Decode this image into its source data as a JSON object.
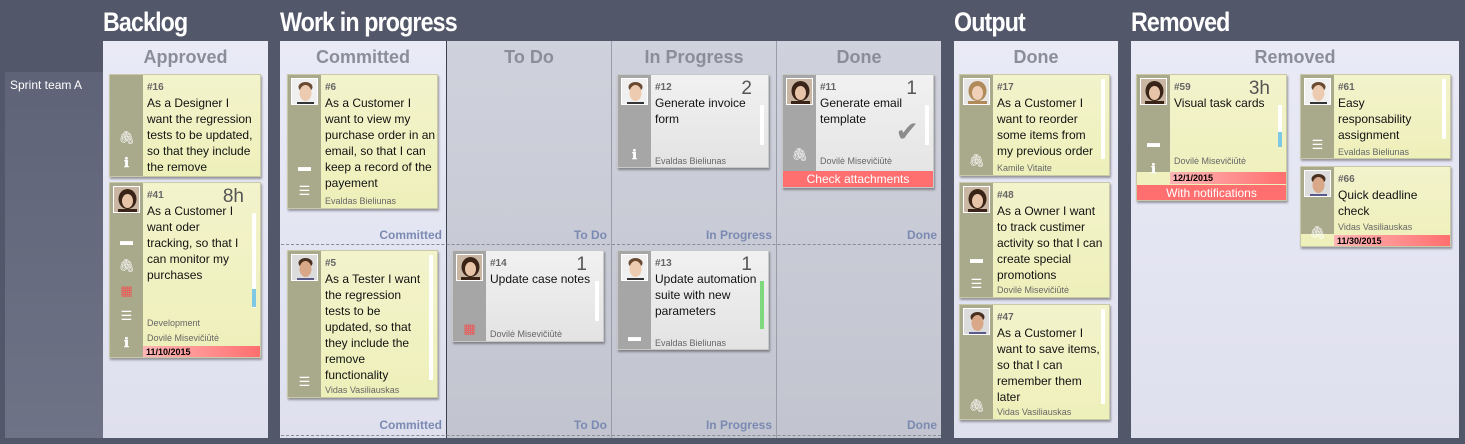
{
  "sections": {
    "backlog": "Backlog",
    "wip": "Work in progress",
    "output": "Output",
    "removed": "Removed"
  },
  "lane": {
    "label": "Sprint team A"
  },
  "columns": {
    "approved": "Approved",
    "committed": "Committed",
    "todo": "To Do",
    "inprogress": "In Progress",
    "done": "Done",
    "output_done": "Done",
    "removed": "Removed"
  },
  "sublabels": {
    "committed_top": "Committed",
    "committed_bottom": "Committed",
    "todo_top": "To Do",
    "todo_bottom": "To Do",
    "inprogress_top": "In Progress",
    "inprogress_bottom": "In Progress",
    "done_top": "Done",
    "done_bottom": "Done"
  },
  "cards": {
    "c16": {
      "id": "#16",
      "title": "As a Designer I want the regression tests to be updated, so that they include the remove functionality"
    },
    "c41": {
      "id": "#41",
      "title": "As a Customer I want oder tracking, so that I can monitor my purchases",
      "estimate": "8h",
      "tag": "Development",
      "owner": "Dovilė Misevičiūtė",
      "date": "11/10/2015"
    },
    "c6": {
      "id": "#6",
      "title": "As a Customer I want to view my purchase order in an email, so that I can keep a record of the payement",
      "owner": "Evaldas Bieliunas"
    },
    "c5": {
      "id": "#5",
      "title": "As a Tester I want the regression tests to be updated, so that they include the remove functionality",
      "owner": "Vidas Vasiliauskas"
    },
    "c14": {
      "id": "#14",
      "title": "Update case notes",
      "estimate": "1",
      "owner": "Dovilė Misevičiūtė"
    },
    "c12": {
      "id": "#12",
      "title": "Generate invoice form",
      "estimate": "2",
      "owner": "Evaldas Bieliunas"
    },
    "c13": {
      "id": "#13",
      "title": "Update automation suite with new parameters",
      "estimate": "1",
      "owner": "Evaldas Bieliunas"
    },
    "c11": {
      "id": "#11",
      "title": "Generate email template",
      "estimate": "1",
      "owner": "Dovilė Misevičiūtė",
      "bar": "Check attachments"
    },
    "c17": {
      "id": "#17",
      "title": "As a Customer I want to reorder some items from my previous order",
      "owner": "Kamile  Vitaite"
    },
    "c48": {
      "id": "#48",
      "title": "As a Owner I want to track custimer activity so that I can create special promotions",
      "owner": "Dovilė Misevičiūtė"
    },
    "c47": {
      "id": "#47",
      "title": "As a Customer I want to save items, so that I can remember them later",
      "owner": "Vidas Vasiliauskas"
    },
    "c59": {
      "id": "#59",
      "title": "Visual task cards",
      "estimate": "3h",
      "owner": "Dovilė Misevičiūtė",
      "date": "12/1/2015",
      "bar": "With notifications"
    },
    "c61": {
      "id": "#61",
      "title": "Easy responsability assignment",
      "owner": "Evaldas Bieliunas"
    },
    "c66": {
      "id": "#66",
      "title": "Quick deadline check",
      "owner": "Vidas Vasiliauskas",
      "date": "11/30/2015"
    }
  },
  "icons": [
    "paperclip-icon",
    "info-icon",
    "comment-icon",
    "calendar-icon",
    "cards-icon",
    "checkmark-icon"
  ],
  "colors": {
    "background": "#53576a",
    "card_yellow": "#f1f2c4",
    "card_white": "#eeeeee",
    "alert_red": "#ff6f6f",
    "marker_blue": "#7ec8e3",
    "marker_green": "#7ed97e"
  }
}
